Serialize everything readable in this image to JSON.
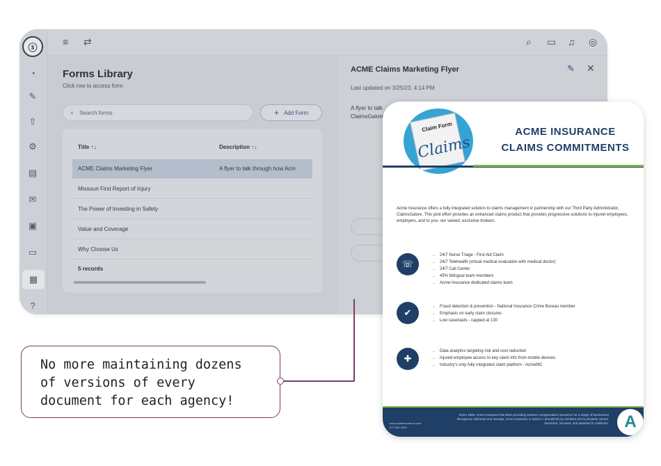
{
  "app": {
    "logo_glyph": "ⓢ",
    "rail_icons": [
      "pie-chart-icon",
      "edit-doc-icon",
      "upload-icon",
      "doc-settings-icon",
      "document-icon",
      "mail-icon",
      "clipboard-icon",
      "card-icon",
      "forms-icon",
      "help-doc-icon"
    ],
    "topbar": {
      "menu_glyph": "≡",
      "swap_glyph": "⇄",
      "search_glyph": "⌕",
      "inbox_glyph": "▭",
      "bell_glyph": "♫",
      "user_glyph": "◎"
    },
    "forms": {
      "title": "Forms Library",
      "subtitle": "Click row to access form",
      "search_placeholder": "Search forms",
      "add_label": "Add Form",
      "columns": [
        "Title ↑↓",
        "Description ↑↓"
      ],
      "rows": [
        {
          "title": "ACME Claims Marketing Flyer",
          "description": "A flyer to talk through how Acm"
        },
        {
          "title": "Missouri First Report of Injury",
          "description": ""
        },
        {
          "title": "The Power of Investing in Safety",
          "description": ""
        },
        {
          "title": "Value and Coverage",
          "description": ""
        },
        {
          "title": "Why Choose Us",
          "description": ""
        }
      ],
      "records": "5 records"
    },
    "detail": {
      "title": "ACME Claims Marketing Flyer",
      "updated": "Last updated on 3/25/23, 4:14 PM",
      "desc_line1": "A flyer to talk",
      "desc_line2": "ClaimsGalore"
    }
  },
  "flyer": {
    "logo_top": "Claim Form",
    "logo_script": "Claims",
    "heading_1": "ACME INSURANCE",
    "heading_2": "CLAIMS COMMITMENTS",
    "intro": "Acme Insurance offers a fully integrated solution to claims management in partnership with our Third Party Administrator, ClaimsGalore. This joint effort provides an enhanced claims product that provides progressive solutions to injured employees, employers, and to you- our valued, exclusive brokers.",
    "section1": [
      "24/7 Nurse Triage - First Aid Claim",
      "24/7 Telehealth (virtual medical evaluation with medical doctor)",
      "24/7 Call Center",
      "45% bilingual team members",
      "Acme Insurance dedicated claims team"
    ],
    "section2": [
      "Fraud detection & prevention - National Insurance Crime Bureau member",
      "Emphasis on early claim closures",
      "Low caseloads - capped at 130"
    ],
    "section3": [
      "Data analytics targeting risk and cost reduction",
      "Injured employee access to key claim info from mobile devices",
      "Industry's only fully integrated claim platform - AcmeMC"
    ],
    "icons": [
      "phone-icon",
      "briefcase-check-icon",
      "medical-doc-icon"
    ],
    "icon_glyphs": [
      "☏",
      "✔",
      "✚"
    ],
    "footer_text": "Since 1996, Acme Insurance has been providing workers compensation insurance for a range of businesses throughout California and Nevada. Acme Insurance is rated A+ (Excellent) by AM Best and is privately owned, domiciled, licensed, and admitted in California.",
    "footer_web": "www.acmeinsurance.com",
    "footer_phone": "877.282.2333",
    "footer_logo": "A"
  },
  "callout": {
    "text": "No more maintaining dozens\nof versions of every\ndocument for each agency!"
  }
}
